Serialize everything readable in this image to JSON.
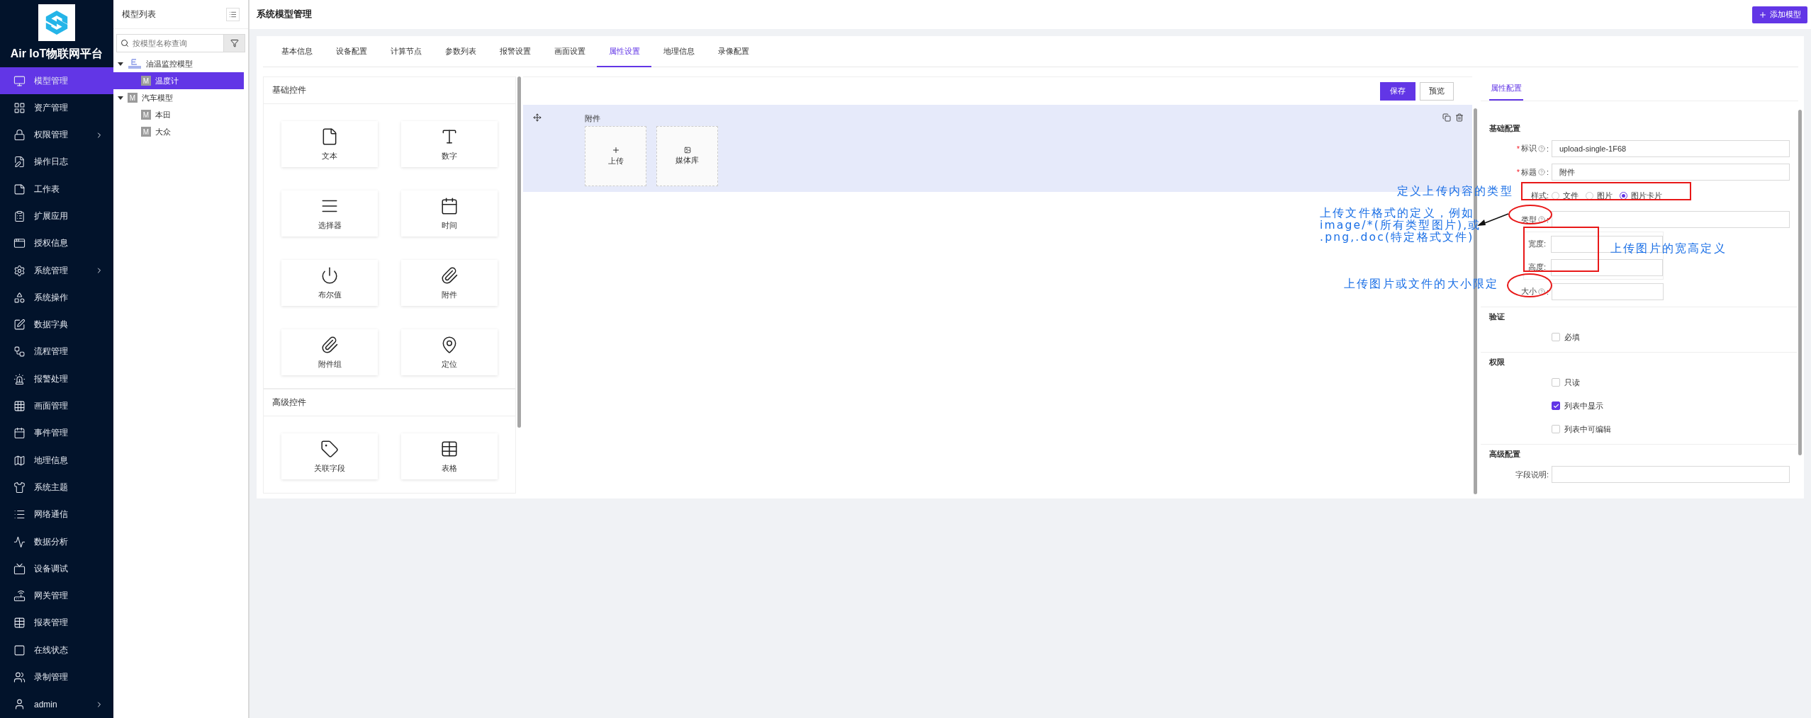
{
  "sidebar": {
    "logo_title": "Air IoT物联网平台",
    "items": [
      {
        "label": "模型管理",
        "selected": true,
        "expandable": false
      },
      {
        "label": "资产管理",
        "selected": false,
        "expandable": false
      },
      {
        "label": "权限管理",
        "selected": false,
        "expandable": true
      },
      {
        "label": "操作日志",
        "selected": false,
        "expandable": false
      },
      {
        "label": "工作表",
        "selected": false,
        "expandable": false
      },
      {
        "label": "扩展应用",
        "selected": false,
        "expandable": false
      },
      {
        "label": "授权信息",
        "selected": false,
        "expandable": false
      },
      {
        "label": "系统管理",
        "selected": false,
        "expandable": true
      },
      {
        "label": "系统操作",
        "selected": false,
        "expandable": false
      },
      {
        "label": "数据字典",
        "selected": false,
        "expandable": false
      },
      {
        "label": "流程管理",
        "selected": false,
        "expandable": false
      },
      {
        "label": "报警处理",
        "selected": false,
        "expandable": false
      },
      {
        "label": "画面管理",
        "selected": false,
        "expandable": false
      },
      {
        "label": "事件管理",
        "selected": false,
        "expandable": false
      },
      {
        "label": "地理信息",
        "selected": false,
        "expandable": false
      },
      {
        "label": "系统主题",
        "selected": false,
        "expandable": false
      },
      {
        "label": "网络通信",
        "selected": false,
        "expandable": false
      },
      {
        "label": "数据分析",
        "selected": false,
        "expandable": false
      },
      {
        "label": "设备调试",
        "selected": false,
        "expandable": false
      },
      {
        "label": "网关管理",
        "selected": false,
        "expandable": false
      },
      {
        "label": "报表管理",
        "selected": false,
        "expandable": false
      },
      {
        "label": "在线状态",
        "selected": false,
        "expandable": false
      },
      {
        "label": "录制管理",
        "selected": false,
        "expandable": false
      },
      {
        "label": "admin",
        "selected": false,
        "expandable": true
      }
    ]
  },
  "tree": {
    "title": "模型列表",
    "search": {
      "placeholder": "按模型名称查询"
    },
    "nodes": [
      {
        "label": "油温监控模型",
        "selected": false,
        "expanded": true,
        "children": [
          {
            "label": "温度计",
            "badge": "M",
            "selected": true
          }
        ]
      },
      {
        "label": "汽车模型",
        "badge": "M",
        "selected": false,
        "expanded": true,
        "children": [
          {
            "label": "本田",
            "badge": "M",
            "selected": false
          },
          {
            "label": "大众",
            "badge": "M",
            "selected": false
          }
        ]
      }
    ]
  },
  "header": {
    "title": "系统模型管理",
    "add_button": "添加模型"
  },
  "tabs": [
    {
      "label": "基本信息",
      "selected": false
    },
    {
      "label": "设备配置",
      "selected": false
    },
    {
      "label": "计算节点",
      "selected": false
    },
    {
      "label": "参数列表",
      "selected": false
    },
    {
      "label": "报警设置",
      "selected": false
    },
    {
      "label": "画面设置",
      "selected": false
    },
    {
      "label": "属性设置",
      "selected": true
    },
    {
      "label": "地理信息",
      "selected": false
    },
    {
      "label": "录像配置",
      "selected": false
    }
  ],
  "palette": [
    {
      "title": "基础控件",
      "items": [
        "文本",
        "数字",
        "选择器",
        "时间",
        "布尔值",
        "附件",
        "附件组",
        "定位"
      ]
    },
    {
      "title": "高级控件",
      "items": [
        "关联字段",
        "表格"
      ]
    }
  ],
  "canvas": {
    "save": "保存",
    "preview": "预览",
    "field": {
      "label": "附件",
      "upload": "上传",
      "library": "媒体库"
    }
  },
  "config": {
    "tab": "属性配置",
    "basic_title": "基础配置",
    "rows": [
      {
        "kind": "input",
        "mark": "*",
        "label": "标识",
        "colon": ":",
        "value": "upload-single-1F68"
      },
      {
        "kind": "input",
        "mark": "*",
        "label": "标题",
        "colon": ":",
        "value": "附件"
      },
      {
        "kind": "radio",
        "label": "样式:",
        "options": [
          {
            "label": "文件",
            "selected": false
          },
          {
            "label": "图片",
            "selected": false
          },
          {
            "label": "图片卡片",
            "selected": true
          }
        ]
      },
      {
        "kind": "input",
        "label": "类型",
        "colon": ":"
      },
      {
        "kind": "dims",
        "fields": [
          "宽度:",
          "高度:"
        ]
      },
      {
        "kind": "short",
        "label": "大小",
        "colon": ":"
      }
    ],
    "groups": [
      {
        "title": "验证",
        "options": [
          {
            "label": "必填",
            "checked": false
          }
        ]
      },
      {
        "title": "权限",
        "options": [
          {
            "label": "只读",
            "checked": false
          },
          {
            "label": "列表中显示",
            "checked": true
          },
          {
            "label": "列表中可编辑",
            "checked": false
          }
        ]
      }
    ],
    "advanced_title": "高级配置",
    "desc_label": "字段说明:"
  },
  "notes": [
    {
      "lines": [
        "定义上传内容的类型"
      ]
    },
    {
      "lines": [
        "上传文件格式的定义，例如",
        "image/*(所有类型图片),或",
        ".png,.doc(特定格式文件)"
      ]
    },
    {
      "lines": [
        "上传图片的宽高定义"
      ]
    },
    {
      "lines": [
        "上传图片或文件的大小限定"
      ]
    }
  ],
  "marks": [
    {
      "kind": "rectangle"
    },
    {
      "kind": "ellipse"
    },
    {
      "kind": "arrow"
    },
    {
      "kind": "rectangle"
    },
    {
      "kind": "ellipse"
    }
  ]
}
